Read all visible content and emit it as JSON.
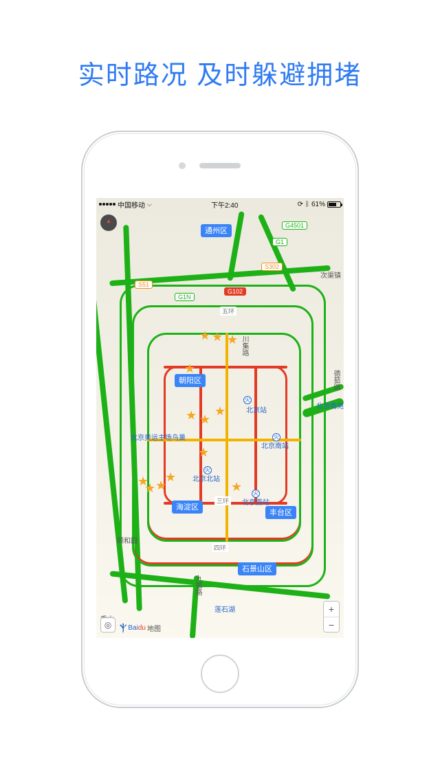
{
  "headline": "实时路况 及时躲避拥堵",
  "status": {
    "carrier": "中国移动",
    "time": "下午2:40",
    "battery_pct": "61%"
  },
  "districts": {
    "tongzhou": "通州区",
    "chaoyang": "朝阳区",
    "haidian": "海淀区",
    "fengtai": "丰台区",
    "shijingshan": "石景山区"
  },
  "road_tags": {
    "g4501": "G4501",
    "g1": "G1",
    "s302": "S302",
    "s51": "S51",
    "g1n": "G1N",
    "g102": "G102"
  },
  "ring_labels": {
    "three": "三环",
    "four": "四环",
    "five": "五环"
  },
  "places": {
    "cixi": "次渠镇",
    "chuanju": "川集路",
    "deru": "德茹路",
    "nanyuan": "北京南苑",
    "beijingzhan": "北京站",
    "nanz": "北京南站",
    "beiz": "北京北站",
    "xiz": "北京西站",
    "olympics": "北京奥运主场鸟巢",
    "yiheyuan": "颐和园",
    "lianshi": "莲石湖",
    "xiangshan": "香山",
    "jiuzu": "九祖路"
  },
  "logo": {
    "brand": "Bai",
    "brand2": "du",
    "sub": "地图"
  },
  "zoom": {
    "in": "+",
    "out": "−"
  },
  "stars": [
    {
      "l": 150,
      "t": 190
    },
    {
      "l": 168,
      "t": 192
    },
    {
      "l": 190,
      "t": 196
    },
    {
      "l": 128,
      "t": 238
    },
    {
      "l": 172,
      "t": 300
    },
    {
      "l": 130,
      "t": 306
    },
    {
      "l": 150,
      "t": 312
    },
    {
      "l": 148,
      "t": 360
    },
    {
      "l": 100,
      "t": 396
    },
    {
      "l": 86,
      "t": 408
    },
    {
      "l": 70,
      "t": 412
    },
    {
      "l": 60,
      "t": 402
    },
    {
      "l": 196,
      "t": 410
    }
  ]
}
